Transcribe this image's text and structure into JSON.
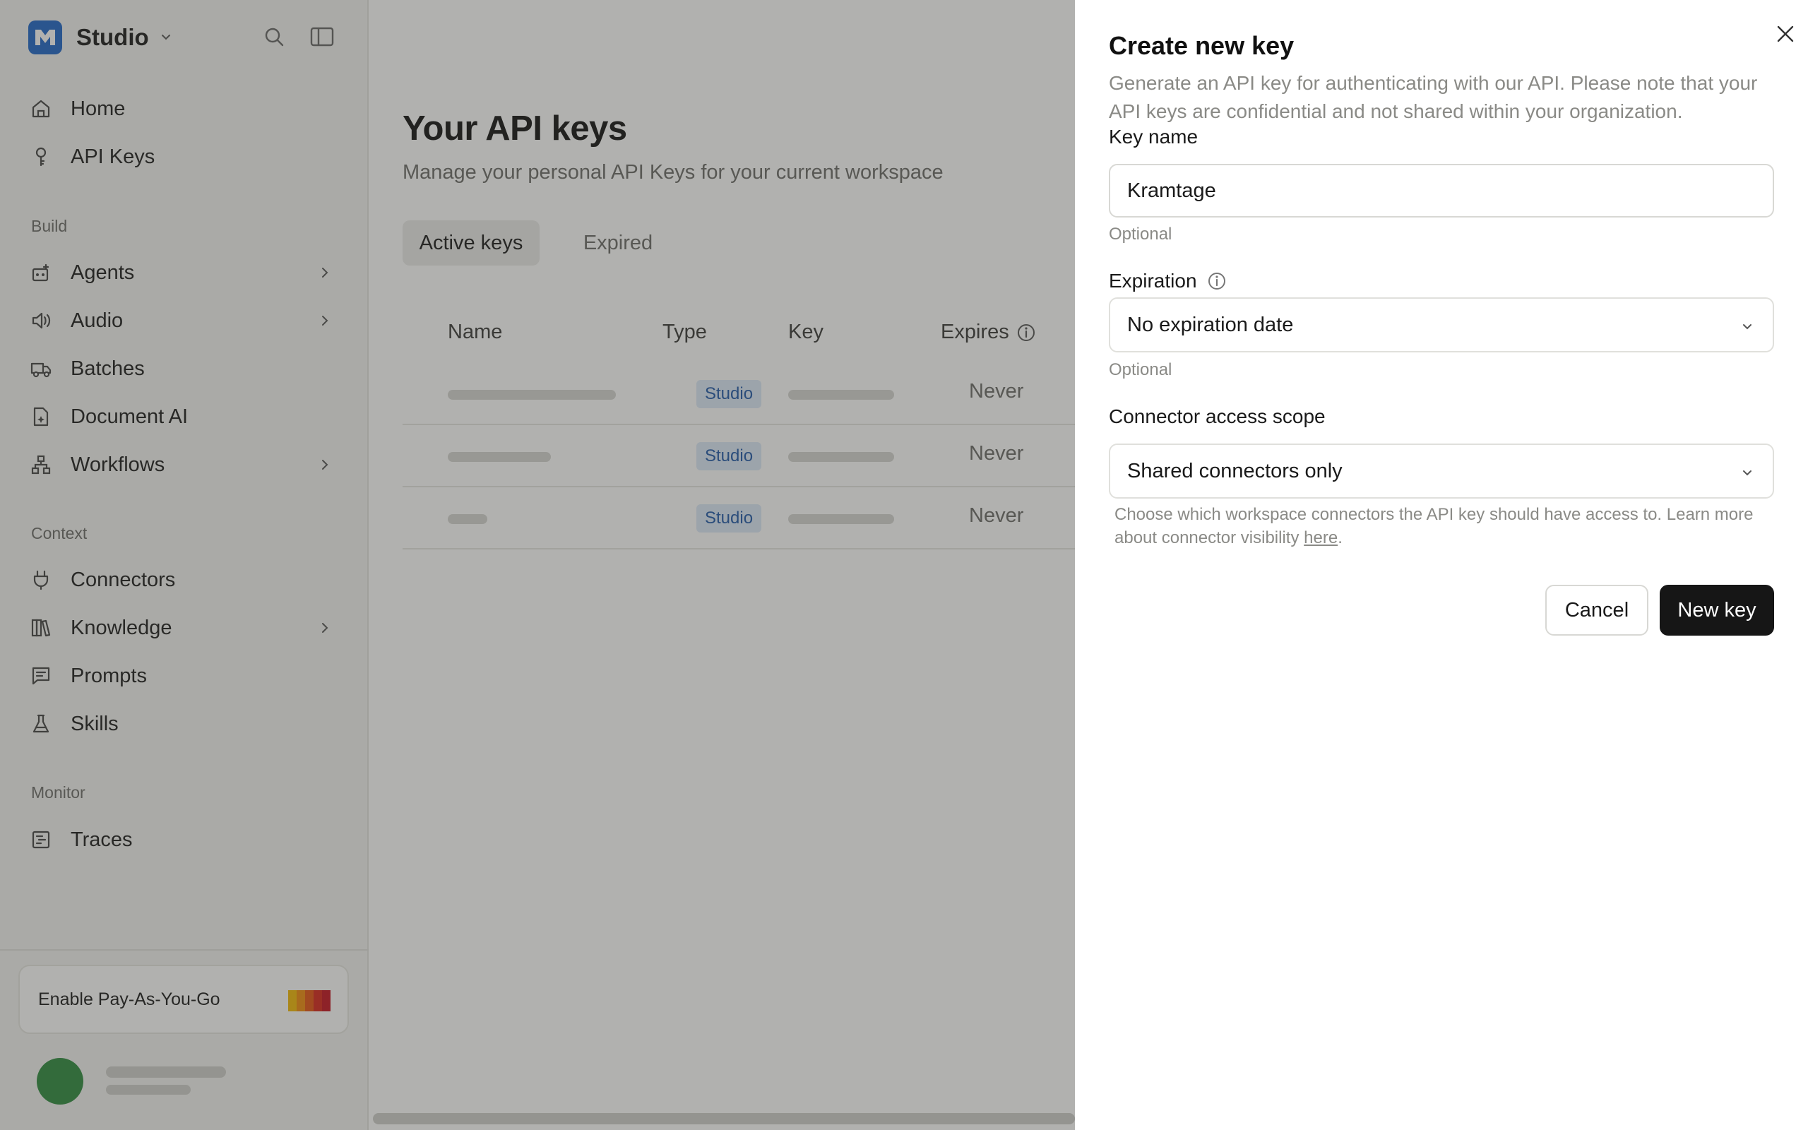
{
  "brand": {
    "name": "Studio"
  },
  "sidebar": {
    "top_items": [
      {
        "label": "Home",
        "icon": "home-icon"
      },
      {
        "label": "API Keys",
        "icon": "key-icon"
      }
    ],
    "sections": [
      {
        "label": "Build",
        "items": [
          {
            "label": "Agents",
            "icon": "agent-icon",
            "has_children": true
          },
          {
            "label": "Audio",
            "icon": "speaker-icon",
            "has_children": true
          },
          {
            "label": "Batches",
            "icon": "truck-icon",
            "has_children": false
          },
          {
            "label": "Document AI",
            "icon": "document-ai-icon",
            "has_children": false
          },
          {
            "label": "Workflows",
            "icon": "workflow-icon",
            "has_children": true
          }
        ]
      },
      {
        "label": "Context",
        "items": [
          {
            "label": "Connectors",
            "icon": "plug-icon",
            "has_children": false
          },
          {
            "label": "Knowledge",
            "icon": "books-icon",
            "has_children": true
          },
          {
            "label": "Prompts",
            "icon": "message-icon",
            "has_children": false
          },
          {
            "label": "Skills",
            "icon": "flask-icon",
            "has_children": false
          }
        ]
      },
      {
        "label": "Monitor",
        "items": [
          {
            "label": "Traces",
            "icon": "traces-icon",
            "has_children": false
          }
        ]
      }
    ],
    "payg_label": "Enable Pay-As-You-Go",
    "payg_colors": [
      "#f2b705",
      "#f08a0c",
      "#e45412",
      "#d8261a",
      "#c4121e"
    ]
  },
  "main": {
    "title": "Your API keys",
    "subtitle": "Manage your personal API Keys for your current workspace",
    "tabs": [
      {
        "label": "Active keys",
        "active": true
      },
      {
        "label": "Expired",
        "active": false
      }
    ],
    "columns": {
      "name": "Name",
      "type": "Type",
      "key": "Key",
      "expires": "Expires"
    },
    "rows": [
      {
        "type": "Studio",
        "expires": "Never"
      },
      {
        "type": "Studio",
        "expires": "Never"
      },
      {
        "type": "Studio",
        "expires": "Never"
      }
    ]
  },
  "drawer": {
    "title": "Create new key",
    "description": "Generate an API key for authenticating with our API. Please note that your API keys are confidential and not shared within your organization.",
    "key_name": {
      "label": "Key name",
      "value": "Kramtage",
      "hint": "Optional"
    },
    "expiration": {
      "label": "Expiration",
      "value": "No expiration date",
      "hint": "Optional"
    },
    "scope": {
      "label": "Connector access scope",
      "value": "Shared connectors only"
    },
    "help_text": "Choose which workspace connectors the API key should have access to. Learn more about connector visibility ",
    "help_link": "here",
    "help_end": ".",
    "cancel_label": "Cancel",
    "submit_label": "New key"
  },
  "colors": {
    "brand": "#1f66c9",
    "primary_button": "#161616",
    "badge_bg": "#dde9f8",
    "badge_text": "#2059a8",
    "avatar": "#2e8a3e"
  }
}
